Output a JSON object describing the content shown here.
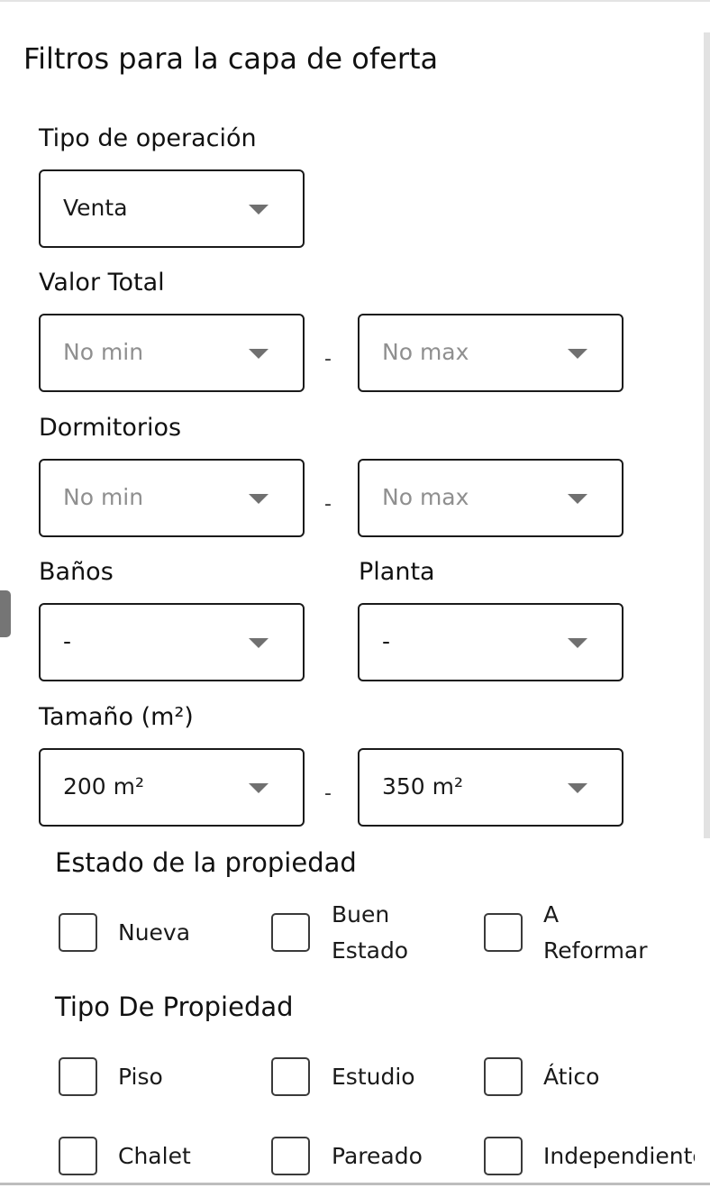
{
  "title": "Filtros para la capa de oferta",
  "operation": {
    "label": "Tipo de operación",
    "value": "Venta"
  },
  "total_value": {
    "label": "Valor Total",
    "min": "No min",
    "max": "No max",
    "separator": "-"
  },
  "bedrooms": {
    "label": "Dormitorios",
    "min": "No min",
    "max": "No max",
    "separator": "-"
  },
  "bathrooms": {
    "label": "Baños",
    "value": "-"
  },
  "floor": {
    "label": "Planta",
    "value": "-"
  },
  "size": {
    "label": "Tamaño (m²)",
    "min": "200 m²",
    "max": "350 m²",
    "separator": "-"
  },
  "property_state": {
    "title": "Estado de la propiedad",
    "options": [
      {
        "line1": "Nueva",
        "line2": ""
      },
      {
        "line1": "Buen",
        "line2": "Estado"
      },
      {
        "line1": "A",
        "line2": "Reformar"
      }
    ]
  },
  "property_type": {
    "title": "Tipo De Propiedad",
    "options": [
      "Piso",
      "Estudio",
      "Ático",
      "Chalet",
      "Pareado",
      "Independiente"
    ]
  },
  "icons": {
    "dropdown": "caret-down-icon"
  },
  "colors": {
    "border": "#1a1a1a",
    "placeholder": "#8f8f8f",
    "caret": "#707070"
  }
}
